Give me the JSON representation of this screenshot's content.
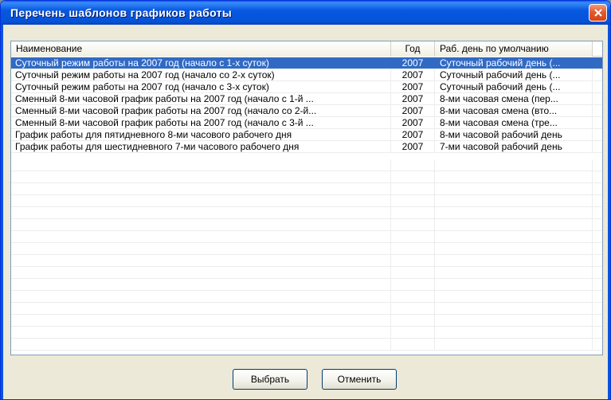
{
  "window": {
    "title": "Перечень шаблонов графиков работы"
  },
  "table": {
    "columns": [
      "Наименование",
      "Год",
      "Раб. день по умолчанию"
    ],
    "rows": [
      {
        "name": "Суточный режим работы на 2007 год (начало с 1-х суток)",
        "year": "2007",
        "day": "Суточный рабочий день (...",
        "selected": true
      },
      {
        "name": "Суточный режим работы на 2007 год (начало со 2-х суток)",
        "year": "2007",
        "day": "Суточный рабочий день (...",
        "selected": false
      },
      {
        "name": "Суточный режим работы на 2007 год (начало с 3-х суток)",
        "year": "2007",
        "day": "Суточный рабочий день (...",
        "selected": false
      },
      {
        "name": "Сменный 8-ми часовой график работы на 2007 год (начало с 1-й ...",
        "year": "2007",
        "day": "8-ми часовая смена (пер...",
        "selected": false
      },
      {
        "name": "Сменный 8-ми часовой график работы на 2007 год (начало со 2-й...",
        "year": "2007",
        "day": "8-ми часовая смена (вто...",
        "selected": false
      },
      {
        "name": "Сменный 8-ми часовой график работы на 2007 год (начало с 3-й ...",
        "year": "2007",
        "day": "8-ми часовая смена (тре...",
        "selected": false
      },
      {
        "name": "График работы для пятидневного 8-ми часового рабочего дня",
        "year": "2007",
        "day": "8-ми часовой рабочий день",
        "selected": false
      },
      {
        "name": "График работы для шестидневного 7-ми часового рабочего дня",
        "year": "2007",
        "day": "7-ми часовой рабочий день",
        "selected": false
      }
    ]
  },
  "buttons": {
    "select_label": "Выбрать",
    "cancel_label": "Отменить"
  },
  "colors": {
    "titlebar": "#0452d8",
    "selection": "#316ac5",
    "close": "#d2451a"
  },
  "icons": {
    "close": "close-icon"
  }
}
